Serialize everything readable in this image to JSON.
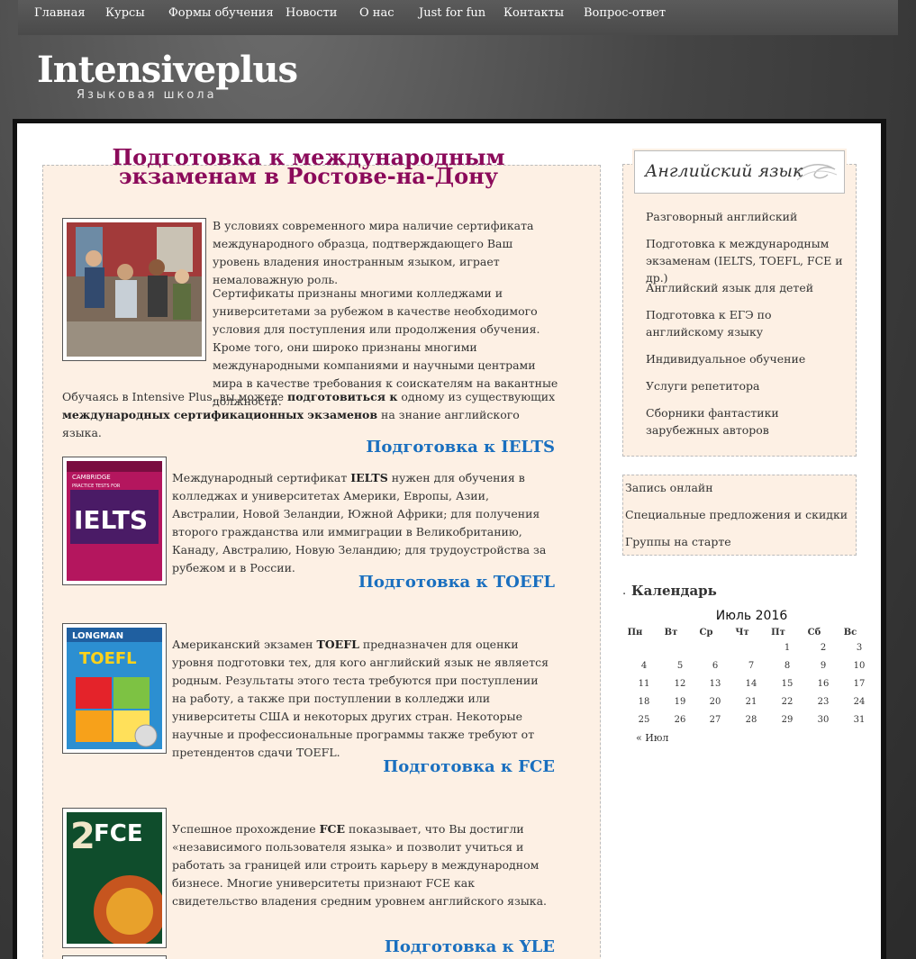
{
  "nav": {
    "items": [
      "Главная",
      "Курсы",
      "Формы обучения",
      "Новости",
      "О нас",
      "Just for fun",
      "Контакты",
      "Вопрос-ответ"
    ]
  },
  "site": {
    "logo": "Intensiveplus",
    "tagline": "Языковая школа"
  },
  "main": {
    "title": "Подготовка к международным экзаменам в Ростове-на-Дону",
    "intro1": "В условиях современного мира наличие сертификата международного образца, подтверждающего Ваш уровень владения иностранным языком, играет немаловажную роль.",
    "intro2": "Сертификаты признаны многими колледжами и университетами за рубежом в качестве необходимого условия для поступления или продолжения обучения. Кроме того, они широко признаны многими международными компаниями и научными центрами мира в качестве требования к соискателям на вакантные должности.",
    "intro3_a": "Обучаясь в Intensive Plus, вы можете ",
    "intro3_b": "подготовиться к",
    "intro3_c": " одному из существующих ",
    "intro3_d": "международных сертификационных экзаменов",
    "intro3_e": " на знание английского языка.",
    "sections": [
      {
        "title": "Подготовка к IELTS",
        "pre": "Международный сертификат ",
        "bold": "IELTS",
        "post": " нужен для обучения в колледжах и университетах Америки, Европы, Азии, Австралии, Новой Зеландии, Южной Африки; для получения второго гражданства или иммиграции в Великобританию, Канаду, Австралию, Новую Зеландию; для трудоустройства за рубежом и в России."
      },
      {
        "title": "Подготовка к TOEFL",
        "pre": "Американский экзамен ",
        "bold": "TOEFL",
        "post": " предназначен для оценки уровня подготовки тех, для кого английский язык не является родным. Результаты этого теста требуются при поступлении на работу, а также при поступлении в колледжи или университеты США и некоторых других стран. Некоторые научные и профессиональные программы также требуют от претендентов сдачи TOEFL."
      },
      {
        "title": "Подготовка к FCE",
        "pre": "Успешное прохождение ",
        "bold": "FCE",
        "post": " показывает, что Вы достигли «независимого пользователя языка» и позволит учиться и работать за границей или строить карьеру в международном бизнесе. Многие университеты признают FCE как свидетельство владения средним уровнем английского языка."
      },
      {
        "title": "Подготовка к YLE"
      }
    ],
    "book_labels": {
      "ielts_top": "CAMBRIDGE",
      "ielts_sub": "PRACTICE TESTS FOR",
      "ielts_big": "IELTS",
      "toefl_top": "LONGMAN",
      "toefl_big": "TOEFL",
      "fce_big": "FCE",
      "fce_num": "2"
    }
  },
  "sidebar": {
    "heading": "Английский язык",
    "links": [
      "Разговорный английский",
      "Подготовка к международным экзаменам (IELTS, TOEFL, FCE и др.)",
      "Английский язык для детей",
      "Подготовка к ЕГЭ по английскому языку",
      "Индивидуальное обучение",
      "Услуги репетитора",
      "Сборники фантастики зарубежных авторов"
    ],
    "links2": [
      "Запись онлайн",
      "Специальные предложения и скидки",
      "Группы на старте"
    ]
  },
  "calendar": {
    "heading": "Календарь",
    "caption": "Июль 2016",
    "weekdays": [
      "Пн",
      "Вт",
      "Ср",
      "Чт",
      "Пт",
      "Сб",
      "Вс"
    ],
    "weeks": [
      [
        "",
        "",
        "",
        "",
        "1",
        "2",
        "3"
      ],
      [
        "4",
        "5",
        "6",
        "7",
        "8",
        "9",
        "10"
      ],
      [
        "11",
        "12",
        "13",
        "14",
        "15",
        "16",
        "17"
      ],
      [
        "18",
        "19",
        "20",
        "21",
        "22",
        "23",
        "24"
      ],
      [
        "25",
        "26",
        "27",
        "28",
        "29",
        "30",
        "31"
      ]
    ],
    "prev": "« Июл"
  }
}
